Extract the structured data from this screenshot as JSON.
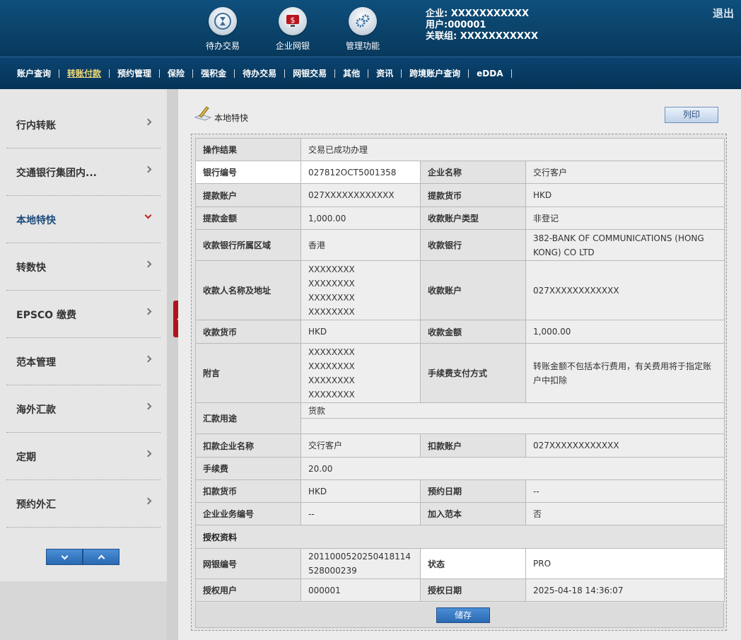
{
  "header": {
    "icons": [
      {
        "label": "待办交易",
        "icon": "hourglass-icon"
      },
      {
        "label": "企业网银",
        "icon": "monitor-dollar-icon"
      },
      {
        "label": "管理功能",
        "icon": "gears-icon"
      }
    ],
    "user": {
      "company": "企业: XXXXXXXXXXX",
      "user": "用户:000001",
      "group": "关联组: XXXXXXXXXXX"
    },
    "logout": "退出"
  },
  "nav": [
    "账户查询",
    "转账付款",
    "预约管理",
    "保险",
    "强积金",
    "待办交易",
    "网银交易",
    "其他",
    "资讯",
    "跨境账户查询",
    "eDDA"
  ],
  "nav_active": "转账付款",
  "sidebar": {
    "items": [
      {
        "label": "行内转账"
      },
      {
        "label": "交通银行集团内..."
      },
      {
        "label": "本地特快"
      },
      {
        "label": "转数快"
      },
      {
        "label": "EPSCO 缴费"
      },
      {
        "label": "范本管理"
      },
      {
        "label": "海外汇款"
      },
      {
        "label": "定期"
      },
      {
        "label": "预约外汇"
      }
    ],
    "active": "本地特快"
  },
  "main": {
    "title": "本地特快",
    "print": "列印",
    "save": "储存",
    "rows": {
      "r0": {
        "k1": "操作结果",
        "v1": "交易已成功办理"
      },
      "r1": {
        "k1": "银行编号",
        "v1": "027812OCT5001358",
        "k2": "企业名称",
        "v2": "交行客户"
      },
      "r2": {
        "k1": "提款账户",
        "v1": "027XXXXXXXXXXXX",
        "k2": "提款货币",
        "v2": "HKD"
      },
      "r3": {
        "k1": "提款金额",
        "v1": "1,000.00",
        "k2": "收款账户类型",
        "v2": "非登记"
      },
      "r4": {
        "k1": "收款银行所属区域",
        "v1": "香港",
        "k2": "收款银行",
        "v2": "382-BANK OF COMMUNICATIONS (HONG KONG) CO LTD"
      },
      "r5": {
        "k1": "收款人名称及地址",
        "v1a": "XXXXXXXX",
        "v1b": "XXXXXXXX",
        "v1c": "XXXXXXXX",
        "v1d": "XXXXXXXX",
        "k2": "收款账户",
        "v2": "027XXXXXXXXXXXX"
      },
      "r6": {
        "k1": "收款货币",
        "v1": "HKD",
        "k2": "收款金额",
        "v2": "1,000.00"
      },
      "r7": {
        "k1": "附言",
        "v1a": "XXXXXXXX",
        "v1b": "XXXXXXXX",
        "v1c": "XXXXXXXX",
        "v1d": "XXXXXXXX",
        "k2": "手续费支付方式",
        "v2": "转账金额不包括本行费用，有关费用将于指定账户中扣除"
      },
      "r8": {
        "k1": "汇款用途",
        "v1": "货款"
      },
      "r9": {
        "k1": "扣款企业名称",
        "v1": "交行客户",
        "k2": "扣款账户",
        "v2": "027XXXXXXXXXXXX"
      },
      "r10": {
        "k1": "手续费",
        "v1": "20.00"
      },
      "r11": {
        "k1": "扣款货币",
        "v1": "HKD",
        "k2": "预约日期",
        "v2": "--"
      },
      "r12": {
        "k1": "企业业务编号",
        "v1": "--",
        "k2": "加入范本",
        "v2": "否"
      },
      "r13": {
        "k1": "授权资料"
      },
      "r14": {
        "k1": "网银编号",
        "v1": "20110005202504181145​28000239",
        "k2": "状态",
        "v2": "PRO"
      },
      "r15": {
        "k1": "授权用户",
        "v1": "000001",
        "k2": "授权日期",
        "v2": "2025-04-18 14:36:07"
      }
    }
  }
}
